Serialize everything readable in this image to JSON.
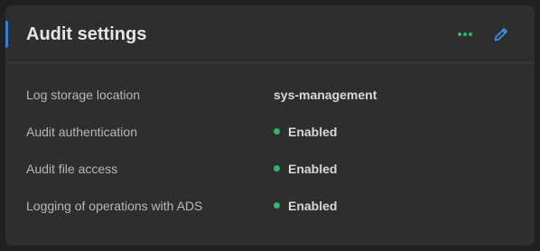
{
  "card": {
    "title": "Audit settings"
  },
  "colors": {
    "accent": "#2f7fd6",
    "more_icon": "#35b56a",
    "edit_icon": "#3b8ee8",
    "status_enabled": "#35b56a"
  },
  "icons": {
    "more": "more-horizontal-icon",
    "edit": "pencil-icon",
    "status": "status-dot-icon"
  },
  "rows": [
    {
      "label": "Log storage location",
      "value": "sys-management",
      "status": null
    },
    {
      "label": "Audit authentication",
      "value": "Enabled",
      "status": "enabled"
    },
    {
      "label": "Audit file access",
      "value": "Enabled",
      "status": "enabled"
    },
    {
      "label": "Logging of operations with ADS",
      "value": "Enabled",
      "status": "enabled"
    }
  ]
}
